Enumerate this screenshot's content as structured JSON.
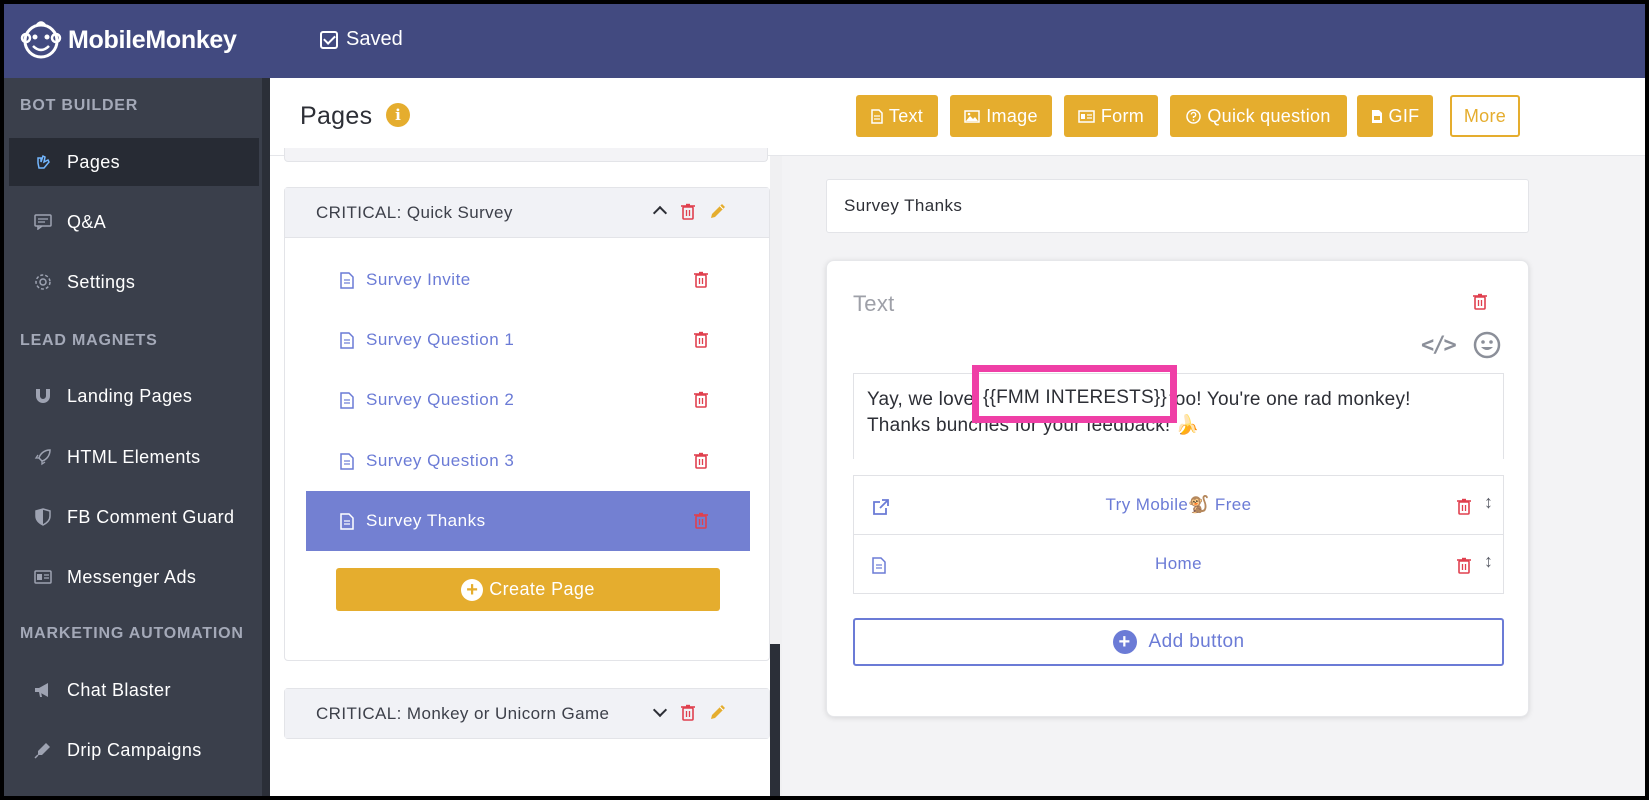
{
  "topbar": {
    "brand": "MobileMonkey",
    "saved_label": "Saved"
  },
  "sidebar": {
    "sections": [
      {
        "title": "BOT BUILDER"
      },
      {
        "title": "LEAD MAGNETS"
      },
      {
        "title": "MARKETING AUTOMATION"
      }
    ],
    "items": [
      {
        "label": "Pages",
        "icon": "hand-pointer-icon",
        "active": true
      },
      {
        "label": "Q&A",
        "icon": "chat-icon"
      },
      {
        "label": "Settings",
        "icon": "gear-icon"
      },
      {
        "label": "Landing Pages",
        "icon": "magnet-icon"
      },
      {
        "label": "HTML Elements",
        "icon": "rocket-icon"
      },
      {
        "label": "FB Comment Guard",
        "icon": "shield-icon"
      },
      {
        "label": "Messenger Ads",
        "icon": "ad-icon"
      },
      {
        "label": "Chat Blaster",
        "icon": "megaphone-icon"
      },
      {
        "label": "Drip Campaigns",
        "icon": "dropper-icon"
      }
    ]
  },
  "header": {
    "title": "Pages",
    "info_glyph": "i",
    "toolbar": [
      {
        "label": "Text",
        "icon": "file-text-icon"
      },
      {
        "label": "Image",
        "icon": "image-icon"
      },
      {
        "label": "Form",
        "icon": "form-icon"
      },
      {
        "label": "Quick question",
        "icon": "question-circle-icon"
      },
      {
        "label": "GIF",
        "icon": "gif-file-icon"
      },
      {
        "label": "More"
      }
    ]
  },
  "page_groups": [
    {
      "title": "CRITICAL: Quick Survey",
      "expanded": true,
      "pages": [
        {
          "label": "Survey Invite"
        },
        {
          "label": "Survey Question 1"
        },
        {
          "label": "Survey Question 2"
        },
        {
          "label": "Survey Question 3"
        },
        {
          "label": "Survey Thanks",
          "active": true
        }
      ],
      "create_label": "Create Page"
    },
    {
      "title": "CRITICAL: Monkey or Unicorn Game",
      "expanded": false
    }
  ],
  "editor": {
    "page_name": "Survey Thanks",
    "block_label": "Text",
    "message_line1_before": "Yay, we love ",
    "message_variable": "{{FMM INTERESTS}}",
    "message_line1_after": " too! You're one rad monkey!",
    "message_line2": "Thanks bunches for your feedback! 🍌",
    "buttons": [
      {
        "label": "Try Mobile🐒 Free",
        "icon": "external-link-icon"
      },
      {
        "label": "Home",
        "icon": "document-icon"
      }
    ],
    "add_button_label": "Add button"
  },
  "colors": {
    "topbar": "#424a80",
    "accent": "#e5ad2e",
    "link": "#6b7bd6",
    "danger": "#e0404f",
    "highlight": "#ef3fa6"
  }
}
